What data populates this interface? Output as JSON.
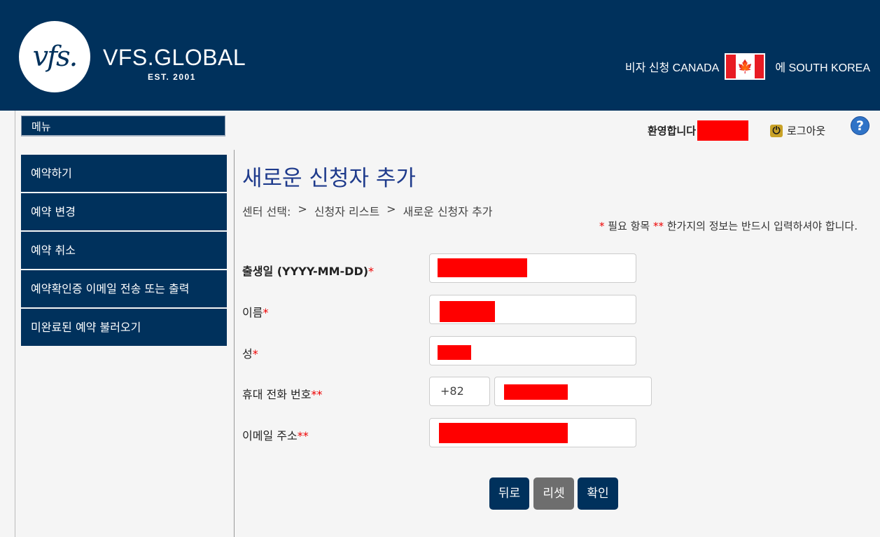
{
  "header": {
    "logo_mark": "vfs.",
    "logo_word": "VFS.GLOBAL",
    "logo_est": "EST. 2001",
    "visa_prefix": "비자 신청 CANADA",
    "visa_suffix": "에 SOUTH KOREA",
    "flag_symbol": "🍁",
    "bg_color": "#00315c"
  },
  "sidebar": {
    "menu_title": "메뉴",
    "items": [
      {
        "label": "예약하기"
      },
      {
        "label": "예약 변경"
      },
      {
        "label": "예약 취소"
      },
      {
        "label": "예약확인증 이메일 전송 또는 출력"
      },
      {
        "label": "미완료된 예약 불러오기"
      }
    ]
  },
  "topbar": {
    "welcome": "환영합니다",
    "logout": "로그아웃",
    "help": "?"
  },
  "main": {
    "title": "새로운 신청자 추가",
    "breadcrumb": [
      "센터 선택:",
      ">",
      "신청자 리스트",
      ">",
      "새로운 신청자 추가"
    ],
    "req_note": {
      "star1": "*",
      "text1": " 필요 항목 ",
      "star2": "**",
      "text2": " 한가지의 정보는 반드시 입력하셔야 합니다."
    },
    "fields": {
      "dob": {
        "label": "출생일 (YYYY-MM-DD)",
        "required": "*"
      },
      "first_name": {
        "label": "이름",
        "required": "*"
      },
      "last_name": {
        "label": "성",
        "required": "*"
      },
      "phone": {
        "label": "휴대 전화 번호",
        "required": "**",
        "country_code": "+82"
      },
      "email": {
        "label": "이메일 주소",
        "required": "**"
      }
    },
    "buttons": {
      "back": "뒤로",
      "reset": "리셋",
      "confirm": "확인"
    }
  }
}
